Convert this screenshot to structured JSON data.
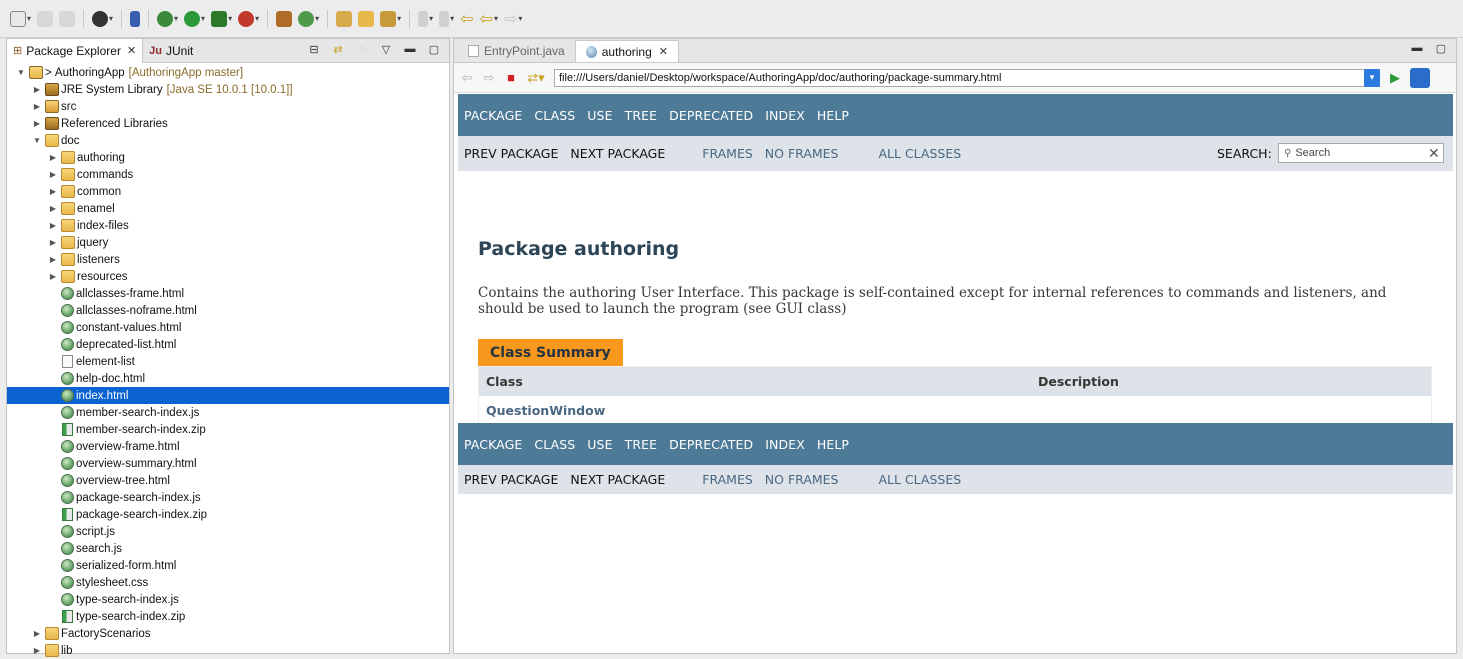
{
  "toolbar": {
    "icons": [
      "new-icon",
      "save-icon",
      "save-all-icon",
      "profile-icon",
      "skip-breakpoints-icon",
      "debug-icon",
      "run-icon",
      "coverage-icon",
      "external-tools-icon",
      "new-java-package-icon",
      "new-class-icon",
      "open-type-icon",
      "open-task-icon",
      "search-icon",
      "annotation-icon",
      "next-annotation-icon",
      "last-edit-icon",
      "back-icon",
      "forward-icon"
    ]
  },
  "left_view": {
    "tabs": [
      {
        "label": "Package Explorer",
        "icon": "package-explorer-icon"
      },
      {
        "label": "JUnit",
        "icon": "junit-icon"
      }
    ],
    "tree": [
      {
        "label": "AuthoringApp",
        "prefix": "> ",
        "deco": "[AuthoringApp master]",
        "icon": "project",
        "level": 0,
        "twisty": "open"
      },
      {
        "label": "JRE System Library",
        "deco": "[Java SE 10.0.1 [10.0.1]]",
        "icon": "jar",
        "level": 1,
        "twisty": "closed"
      },
      {
        "label": "src",
        "icon": "src",
        "level": 1,
        "twisty": "closed"
      },
      {
        "label": "Referenced Libraries",
        "icon": "jar",
        "level": 1,
        "twisty": "closed"
      },
      {
        "label": "doc",
        "icon": "folder",
        "level": 1,
        "twisty": "open"
      },
      {
        "label": "authoring",
        "icon": "folder",
        "level": 2,
        "twisty": "closed"
      },
      {
        "label": "commands",
        "icon": "folder",
        "level": 2,
        "twisty": "closed"
      },
      {
        "label": "common",
        "icon": "folder",
        "level": 2,
        "twisty": "closed"
      },
      {
        "label": "enamel",
        "icon": "folder",
        "level": 2,
        "twisty": "closed"
      },
      {
        "label": "index-files",
        "icon": "folder",
        "level": 2,
        "twisty": "closed"
      },
      {
        "label": "jquery",
        "icon": "folder",
        "level": 2,
        "twisty": "closed"
      },
      {
        "label": "listeners",
        "icon": "folder",
        "level": 2,
        "twisty": "closed"
      },
      {
        "label": "resources",
        "icon": "folder",
        "level": 2,
        "twisty": "closed"
      },
      {
        "label": "allclasses-frame.html",
        "icon": "globe",
        "level": 2
      },
      {
        "label": "allclasses-noframe.html",
        "icon": "globe",
        "level": 2
      },
      {
        "label": "constant-values.html",
        "icon": "globe",
        "level": 2
      },
      {
        "label": "deprecated-list.html",
        "icon": "globe",
        "level": 2
      },
      {
        "label": "element-list",
        "icon": "file",
        "level": 2
      },
      {
        "label": "help-doc.html",
        "icon": "globe",
        "level": 2
      },
      {
        "label": "index.html",
        "icon": "globe",
        "level": 2,
        "selected": true
      },
      {
        "label": "member-search-index.js",
        "icon": "globe",
        "level": 2
      },
      {
        "label": "member-search-index.zip",
        "icon": "zip",
        "level": 2
      },
      {
        "label": "overview-frame.html",
        "icon": "globe",
        "level": 2
      },
      {
        "label": "overview-summary.html",
        "icon": "globe",
        "level": 2
      },
      {
        "label": "overview-tree.html",
        "icon": "globe",
        "level": 2
      },
      {
        "label": "package-search-index.js",
        "icon": "globe",
        "level": 2
      },
      {
        "label": "package-search-index.zip",
        "icon": "zip",
        "level": 2
      },
      {
        "label": "script.js",
        "icon": "globe",
        "level": 2
      },
      {
        "label": "search.js",
        "icon": "globe",
        "level": 2
      },
      {
        "label": "serialized-form.html",
        "icon": "globe",
        "level": 2
      },
      {
        "label": "stylesheet.css",
        "icon": "globe",
        "level": 2
      },
      {
        "label": "type-search-index.js",
        "icon": "globe",
        "level": 2
      },
      {
        "label": "type-search-index.zip",
        "icon": "zip",
        "level": 2
      },
      {
        "label": "FactoryScenarios",
        "icon": "folder",
        "level": 1,
        "twisty": "closed"
      },
      {
        "label": "lib",
        "icon": "folder",
        "level": 1,
        "twisty": "closed"
      }
    ]
  },
  "editor": {
    "tabs": [
      {
        "label": "EntryPoint.java",
        "active": false
      },
      {
        "label": "authoring",
        "active": true
      }
    ],
    "url": "file:///Users/daniel/Desktop/workspace/AuthoringApp/doc/authoring/package-summary.html"
  },
  "javadoc": {
    "topnav": [
      "PACKAGE",
      "CLASS",
      "USE",
      "TREE",
      "DEPRECATED",
      "INDEX",
      "HELP"
    ],
    "subnav": {
      "prev": "PREV PACKAGE",
      "next": "NEXT PACKAGE",
      "frames": "FRAMES",
      "noframes": "NO FRAMES",
      "allclasses": "ALL CLASSES",
      "search_label": "SEARCH:",
      "search_placeholder": "Search"
    },
    "title": "Package authoring",
    "description": "Contains the authoring User Interface. This package is self-contained except for internal references to commands and listeners, and should be used to launch the program (see GUI class)",
    "summary": {
      "caption": "Class Summary",
      "col_class": "Class",
      "col_desc": "Description",
      "rows": [
        {
          "class": "QuestionWindow",
          "desc": ""
        }
      ]
    }
  },
  "colors": {
    "nav_bg": "#4d7a97",
    "subnav_bg": "#dee3e9",
    "caption_bg": "#f8981d",
    "selection": "#0b63d2",
    "link": "#4a6782"
  }
}
